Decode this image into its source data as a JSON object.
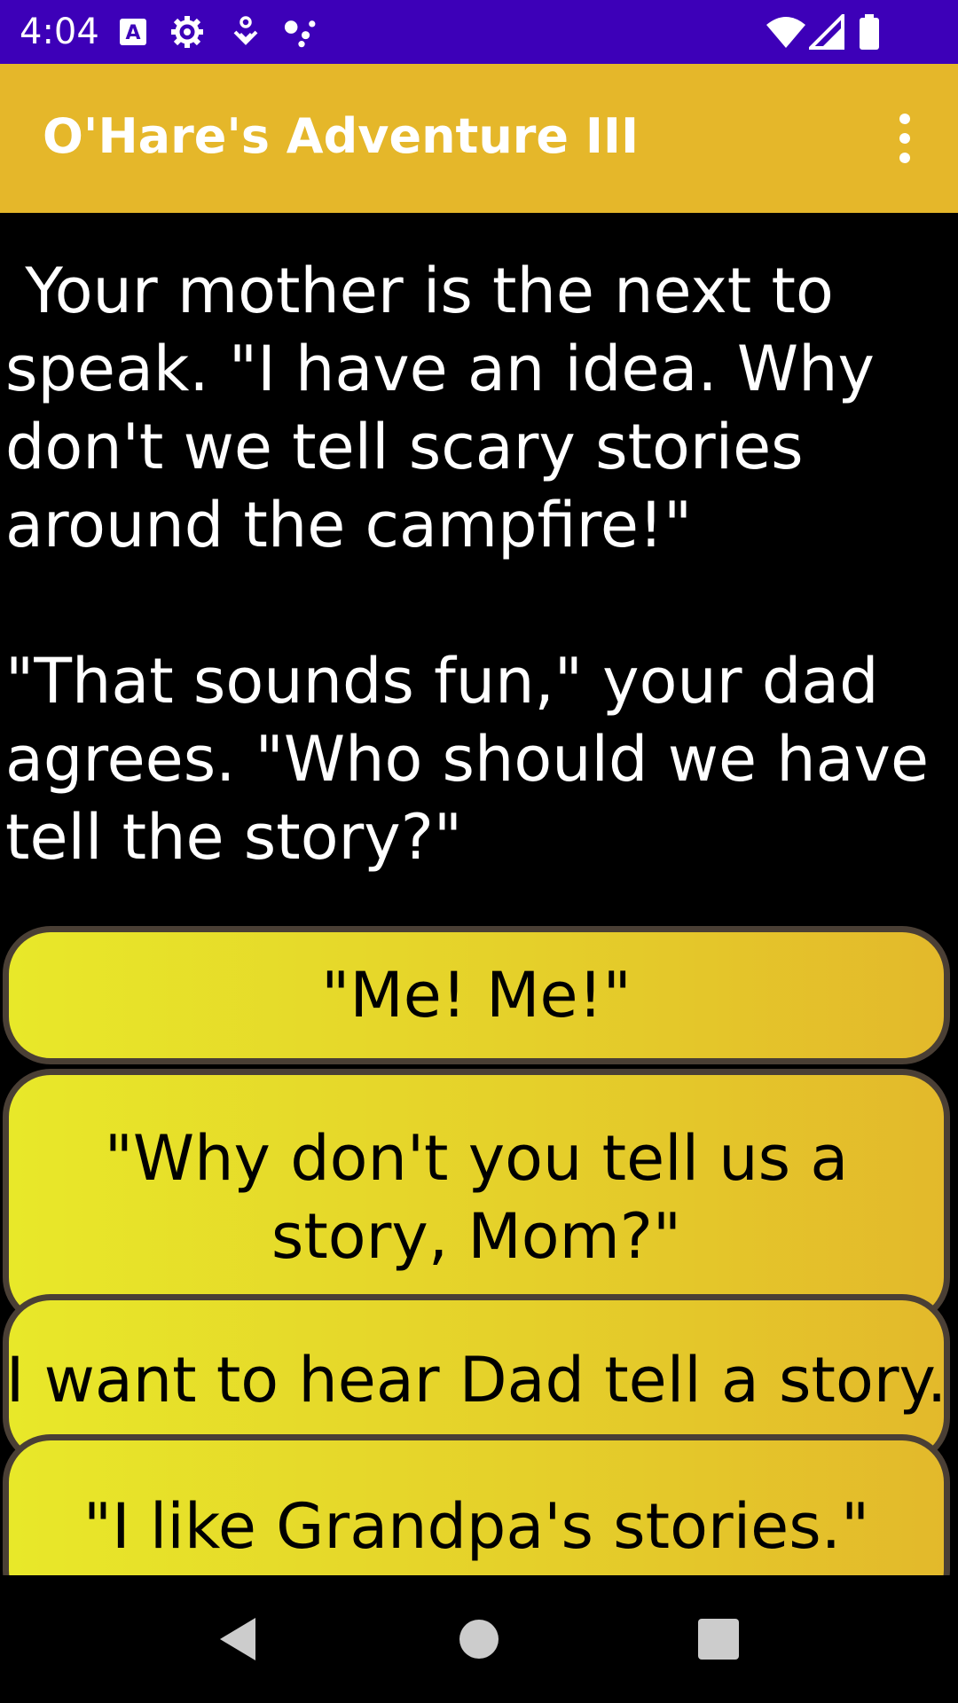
{
  "status_bar": {
    "time": "4:04",
    "left_icons": [
      "text-icon",
      "gear-icon",
      "download-icon",
      "assistant-icon"
    ],
    "right_icons": [
      "wifi-icon",
      "signal-icon",
      "battery-icon"
    ],
    "background": "#3d00b8"
  },
  "app_bar": {
    "title": "O'Hare's Adventure III",
    "background": "#e5b72a",
    "menu_icon": "more-vert-icon"
  },
  "story": {
    "paragraph_1": " Your mother is the next to speak. \"I have an idea. Why don't we tell scary stories around the campfire!\"",
    "paragraph_2": "\"That sounds fun,\" your dad agrees. \"Who should we have tell the story?\""
  },
  "choices": [
    {
      "label": "\"Me! Me!\""
    },
    {
      "label": "\"Why don't you tell us a story, Mom?\""
    },
    {
      "label": "\"I want to hear Dad tell a story.\""
    },
    {
      "label": "\"I like Grandpa's stories.\""
    }
  ],
  "nav_bar": {
    "buttons": [
      "back-icon",
      "home-icon",
      "recents-icon"
    ]
  },
  "colors": {
    "button_gradient_start": "#e8e829",
    "button_gradient_end": "#e3b92b",
    "button_border": "#4a3f35"
  }
}
